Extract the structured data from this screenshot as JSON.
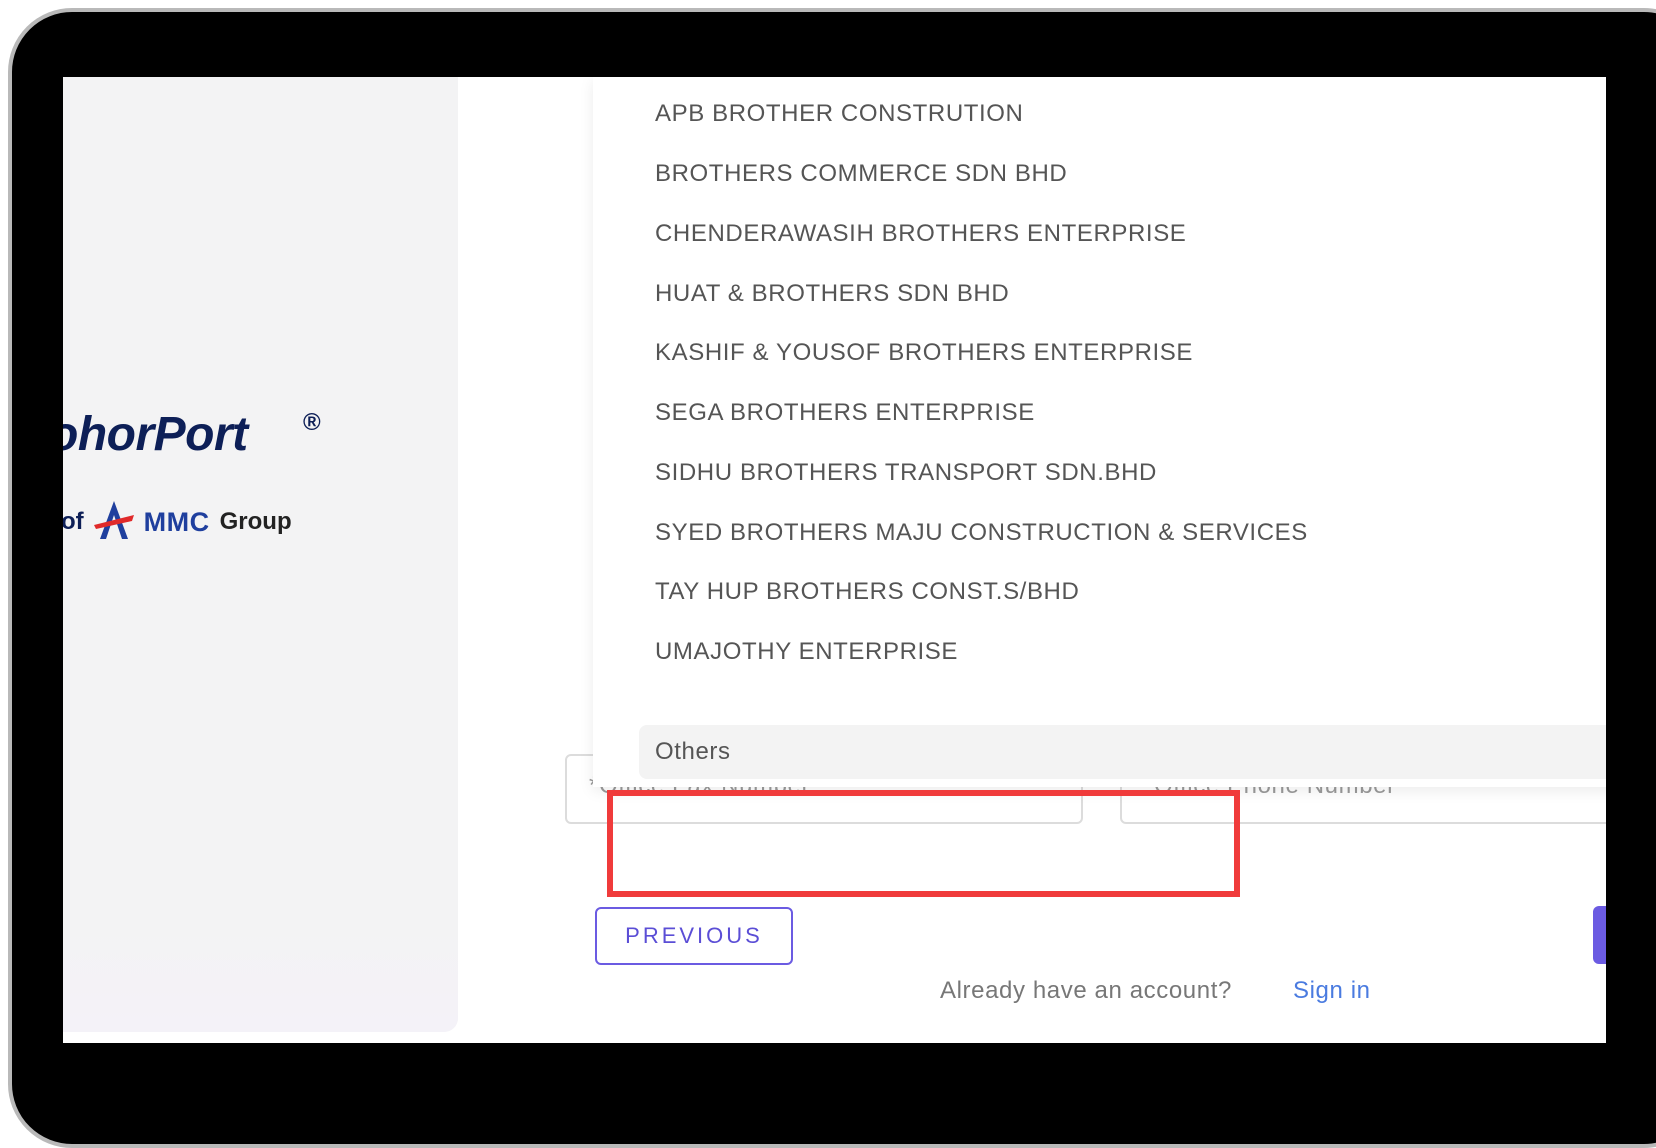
{
  "branding": {
    "logo_text": "JohorPort",
    "logo_visible_text": "ohorPort",
    "registered_mark": "®",
    "sub_of": "of",
    "sub_company": "MMC",
    "sub_group": "Group"
  },
  "company_dropdown": {
    "items": [
      "APB BROTHER CONSTRUTION",
      "BROTHERS COMMERCE SDN BHD",
      "CHENDERAWASIH BROTHERS ENTERPRISE",
      "HUAT & BROTHERS SDN BHD",
      "KASHIF & YOUSOF BROTHERS ENTERPRISE",
      "SEGA BROTHERS ENTERPRISE",
      "SIDHU BROTHERS TRANSPORT SDN.BHD",
      "SYED BROTHERS MAJU CONSTRUCTION & SERVICES",
      "TAY HUP BROTHERS CONST.S/BHD",
      "UMAJOTHY ENTERPRISE"
    ],
    "selected": "Others"
  },
  "form": {
    "fax_placeholder": "*Office Fax Number",
    "phone_placeholder": "*Office Phone Number",
    "previous_label": "PREVIOUS"
  },
  "footer": {
    "prompt": "Already have an account?",
    "signin_label": "Sign in"
  },
  "colors": {
    "accent": "#6b5be2",
    "highlight": "#f03b3b",
    "link": "#4a7be0",
    "logo": "#0d1f57"
  }
}
